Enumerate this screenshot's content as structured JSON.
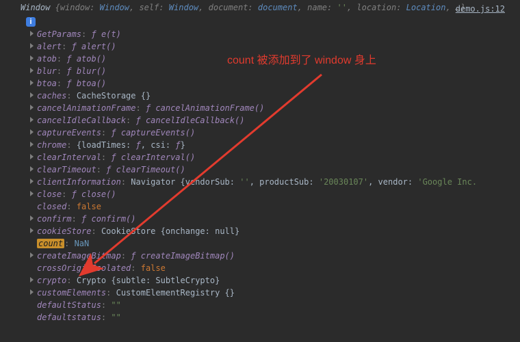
{
  "file_link": "demo.js:12",
  "root": {
    "type": "Window",
    "summary_parts": [
      {
        "k": "window",
        "v": "Window",
        "cls": "obj"
      },
      {
        "k": "self",
        "v": "Window",
        "cls": "obj"
      },
      {
        "k": "document",
        "v": "document",
        "cls": "obj"
      },
      {
        "k": "name",
        "v": "''",
        "cls": "str"
      },
      {
        "k": "location",
        "v": "Location",
        "cls": "obj"
      }
    ]
  },
  "annotation": "count 被添加到了 window 身上",
  "rows": [
    {
      "caret": true,
      "key": "GetParams",
      "sep": ": ",
      "val": "ƒ ",
      "cls": "func",
      "sig": "e(t)"
    },
    {
      "caret": true,
      "key": "alert",
      "sep": ": ",
      "val": "ƒ ",
      "cls": "func",
      "sig": "alert()"
    },
    {
      "caret": true,
      "key": "atob",
      "sep": ": ",
      "val": "ƒ ",
      "cls": "func",
      "sig": "atob()"
    },
    {
      "caret": true,
      "key": "blur",
      "sep": ": ",
      "val": "ƒ ",
      "cls": "func",
      "sig": "blur()"
    },
    {
      "caret": true,
      "key": "btoa",
      "sep": ": ",
      "val": "ƒ ",
      "cls": "func",
      "sig": "btoa()"
    },
    {
      "caret": true,
      "key": "caches",
      "sep": ": ",
      "val": "CacheStorage {}",
      "cls": "plain"
    },
    {
      "caret": true,
      "key": "cancelAnimationFrame",
      "sep": ": ",
      "val": "ƒ ",
      "cls": "func",
      "sig": "cancelAnimationFrame()"
    },
    {
      "caret": true,
      "key": "cancelIdleCallback",
      "sep": ": ",
      "val": "ƒ ",
      "cls": "func",
      "sig": "cancelIdleCallback()"
    },
    {
      "caret": true,
      "key": "captureEvents",
      "sep": ": ",
      "val": "ƒ ",
      "cls": "func",
      "sig": "captureEvents()"
    },
    {
      "caret": true,
      "key": "chrome",
      "sep": ": ",
      "raw": "{loadTimes: <span class='func'>ƒ</span>, csi: <span class='func'>ƒ</span>}"
    },
    {
      "caret": true,
      "key": "clearInterval",
      "sep": ": ",
      "val": "ƒ ",
      "cls": "func",
      "sig": "clearInterval()"
    },
    {
      "caret": true,
      "key": "clearTimeout",
      "sep": ": ",
      "val": "ƒ ",
      "cls": "func",
      "sig": "clearTimeout()"
    },
    {
      "caret": true,
      "key": "clientInformation",
      "sep": ": ",
      "raw": "Navigator {vendorSub: <span class='str'>''</span>, productSub: <span class='str'>'20030107'</span>, vendor: <span class='str'>'Google Inc.</span>"
    },
    {
      "caret": true,
      "key": "close",
      "sep": ": ",
      "val": "ƒ ",
      "cls": "func",
      "sig": "close()"
    },
    {
      "caret": false,
      "key": "closed",
      "sep": ": ",
      "val": "false",
      "cls": "bool"
    },
    {
      "caret": true,
      "key": "confirm",
      "sep": ": ",
      "val": "ƒ ",
      "cls": "func",
      "sig": "confirm()"
    },
    {
      "caret": true,
      "key": "cookieStore",
      "sep": ": ",
      "raw": "CookieStore {onchange: <span class='plain'>null</span>}"
    },
    {
      "caret": false,
      "highlight": true,
      "key": "count",
      "sep": ": ",
      "val": "NaN",
      "cls": "num"
    },
    {
      "caret": true,
      "key": "createImageBitmap",
      "sep": ": ",
      "val": "ƒ ",
      "cls": "func",
      "sig": "createImageBitmap()"
    },
    {
      "caret": false,
      "key": "crossOriginIsolated",
      "sep": ": ",
      "val": "false",
      "cls": "bool"
    },
    {
      "caret": true,
      "key": "crypto",
      "sep": ": ",
      "raw": "Crypto {subtle: SubtleCrypto}"
    },
    {
      "caret": true,
      "key": "customElements",
      "sep": ": ",
      "val": "CustomElementRegistry {}",
      "cls": "plain"
    },
    {
      "caret": false,
      "key": "defaultStatus",
      "sep": ": ",
      "val": "\"\"",
      "cls": "str"
    },
    {
      "caret": false,
      "key": "defaultstatus",
      "sep": ": ",
      "val": "\"\"",
      "cls": "str"
    }
  ]
}
